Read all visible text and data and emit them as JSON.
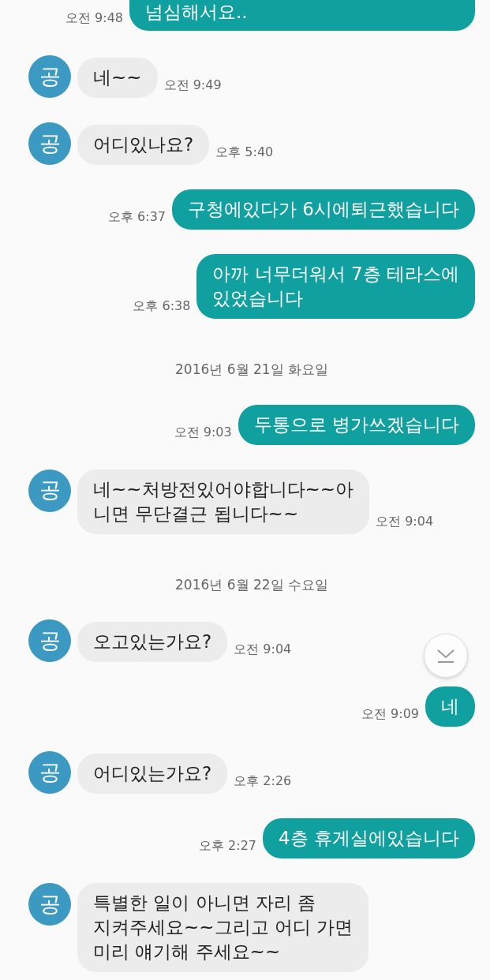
{
  "messages": [
    {
      "kind": "out",
      "text": "넘심해서요..",
      "time": "오전 9:48",
      "clipped_top": true
    },
    {
      "kind": "in",
      "avatar": "공",
      "text": "네~~",
      "time": "오전 9:49"
    },
    {
      "kind": "in",
      "avatar": "공",
      "text": "어디있나요?",
      "time": "오후 5:40"
    },
    {
      "kind": "out",
      "text": "구청에있다가 6시에퇴근했습니다",
      "time": "오후 6:37"
    },
    {
      "kind": "out",
      "text": "아까 너무더워서 7층 테라스에\n있었습니다",
      "time": "오후 6:38"
    },
    {
      "kind": "date",
      "text": "2016년 6월 21일 화요일"
    },
    {
      "kind": "out",
      "text": "두통으로 병가쓰겠습니다",
      "time": "오전 9:03"
    },
    {
      "kind": "in",
      "avatar": "공",
      "text": "네~~처방전있어야합니다~~아\n니면 무단결근 됩니다~~",
      "time": "오전 9:04"
    },
    {
      "kind": "date",
      "text": "2016년 6월 22일 수요일"
    },
    {
      "kind": "in",
      "avatar": "공",
      "text": "오고있는가요?",
      "time": "오전 9:04"
    },
    {
      "kind": "out",
      "text": "네",
      "time": "오전 9:09"
    },
    {
      "kind": "in",
      "avatar": "공",
      "text": "어디있는가요?",
      "time": "오후 2:26"
    },
    {
      "kind": "out",
      "text": "4층 휴게실에있습니다",
      "time": "오후 2:27"
    },
    {
      "kind": "in",
      "avatar": "공",
      "text": "특별한 일이 아니면 자리 좀\n지켜주세요~~그리고 어디 가면\n미리 얘기해 주세요~~"
    }
  ]
}
